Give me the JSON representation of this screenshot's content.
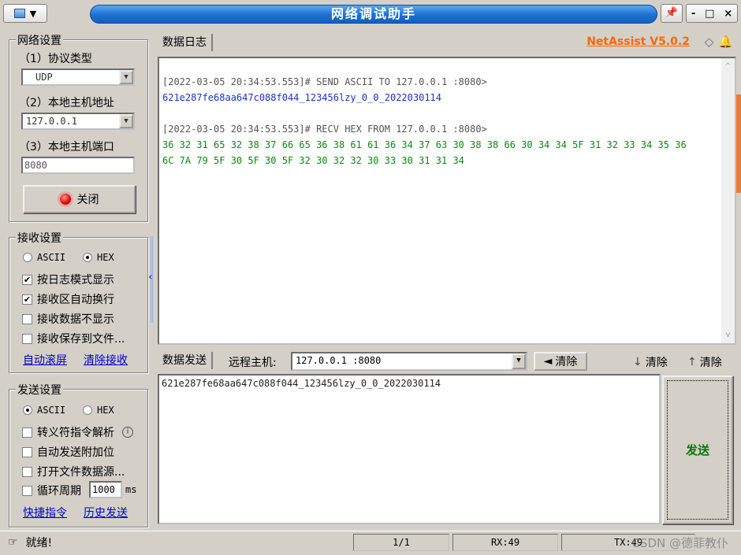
{
  "window": {
    "title": "网络调试助手",
    "brand": "NetAssist V5.0.2",
    "controls": [
      "-",
      "□",
      "×"
    ]
  },
  "network": {
    "group_title": "网络设置",
    "protocol_label": "（1）协议类型",
    "protocol_value": "UDP",
    "host_label": "（2）本地主机地址",
    "host_value": "127.0.0.1",
    "port_label": "（3）本地主机端口",
    "port_value": "8080",
    "close_button": "关闭"
  },
  "receive": {
    "group_title": "接收设置",
    "ascii": "ASCII",
    "hex": "HEX",
    "options": [
      {
        "label": "按日志模式显示",
        "checked": "✔"
      },
      {
        "label": "接收区自动换行",
        "checked": "✔"
      },
      {
        "label": "接收数据不显示",
        "checked": ""
      },
      {
        "label": "接收保存到文件...",
        "checked": ""
      }
    ],
    "auto_scroll": "自动滚屏",
    "clear_receive": "清除接收"
  },
  "send": {
    "group_title": "发送设置",
    "ascii": "ASCII",
    "hex": "HEX",
    "options": [
      {
        "label": "转义符指令解析",
        "checked": ""
      },
      {
        "label": "自动发送附加位",
        "checked": ""
      },
      {
        "label": "打开文件数据源...",
        "checked": ""
      },
      {
        "label": "循环周期",
        "checked": ""
      }
    ],
    "period_value": "1000",
    "period_unit": "ms",
    "shortcuts": "快捷指令",
    "history": "历史发送"
  },
  "log": {
    "tab": "数据日志",
    "lines": [
      {
        "text": "[2022-03-05 20:34:53.553]# SEND ASCII TO 127.0.0.1 :8080>",
        "kind": "head"
      },
      {
        "text": "621e287fe68aa647c088f044_123456lzy_0_0_2022030114",
        "kind": "blue"
      },
      {
        "text": "",
        "kind": "head"
      },
      {
        "text": "[2022-03-05 20:34:53.553]# RECV HEX FROM 127.0.0.1 :8080>",
        "kind": "head"
      },
      {
        "text": "36 32 31 65 32 38 37 66 65 36 38 61 61 36 34 37 63 30 38 38 66 30 34 34 5F 31 32 33 34 35 36",
        "kind": "green"
      },
      {
        "text": "6C 7A 79 5F 30 5F 30 5F 32 30 32 32 30 33 30 31 31 34",
        "kind": "green"
      }
    ]
  },
  "sendbar": {
    "tab": "数据发送",
    "remote_label": "远程主机:",
    "remote_value": "127.0.0.1 :8080",
    "clear_remote": "清除",
    "clear1": "清除",
    "clear2": "清除",
    "input_value": "621e287fe68aa647c088f044_123456lzy_0_0_2022030114",
    "send_button": "发送"
  },
  "status": {
    "ready": "就绪!",
    "page": "1/1",
    "rx": "RX:49",
    "tx": "TX:49",
    "watermark": "CSDN @德菲教仆"
  }
}
